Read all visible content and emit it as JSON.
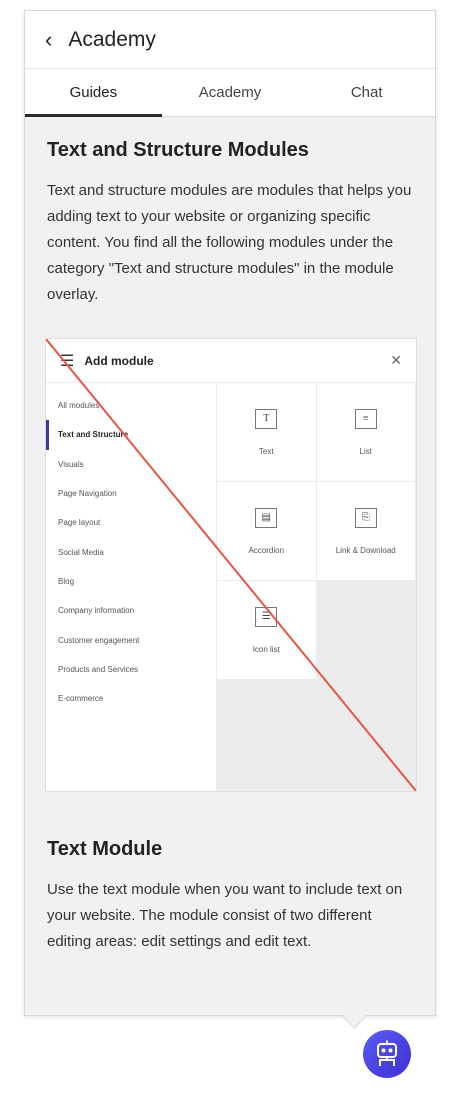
{
  "header": {
    "back_icon": "chevron-left-icon",
    "title": "Academy"
  },
  "tabs": [
    {
      "label": "Guides",
      "active": true
    },
    {
      "label": "Academy",
      "active": false
    },
    {
      "label": "Chat",
      "active": false
    }
  ],
  "section1": {
    "title": "Text and Structure Modules",
    "body": "Text and structure modules are modules that helps you adding text to your website or organizing specific content. You find all the following modules under the category \"Text and structure modules\" in the module overlay."
  },
  "screenshot": {
    "title": "Add module",
    "menu_icon": "hamburger-icon",
    "close_icon": "close-icon",
    "categories": [
      {
        "label": "All modules",
        "active": false
      },
      {
        "label": "Text and Structure",
        "active": true
      },
      {
        "label": "Visuals",
        "active": false
      },
      {
        "label": "Page Navigation",
        "active": false
      },
      {
        "label": "Page layout",
        "active": false
      },
      {
        "label": "Social Media",
        "active": false
      },
      {
        "label": "Blog",
        "active": false
      },
      {
        "label": "Company information",
        "active": false
      },
      {
        "label": "Customer engagement",
        "active": false
      },
      {
        "label": "Products and Services",
        "active": false
      },
      {
        "label": "E-commerce",
        "active": false
      }
    ],
    "tiles": [
      {
        "label": "Text",
        "icon": "T"
      },
      {
        "label": "List",
        "icon": "≡"
      },
      {
        "label": "Accordion",
        "icon": "▤"
      },
      {
        "label": "Link & Download",
        "icon": "⎘"
      },
      {
        "label": "Icon list",
        "icon": "☰"
      }
    ],
    "strike_color": "#e8553f"
  },
  "section2": {
    "title": "Text Module",
    "body": "Use the text module when you want to include text on your website. The module consist of two different editing areas: edit settings and edit text."
  },
  "bot_icon": "robot-icon",
  "colors": {
    "accent": "#4a45e6",
    "panel_bg": "#f1f1f1"
  }
}
